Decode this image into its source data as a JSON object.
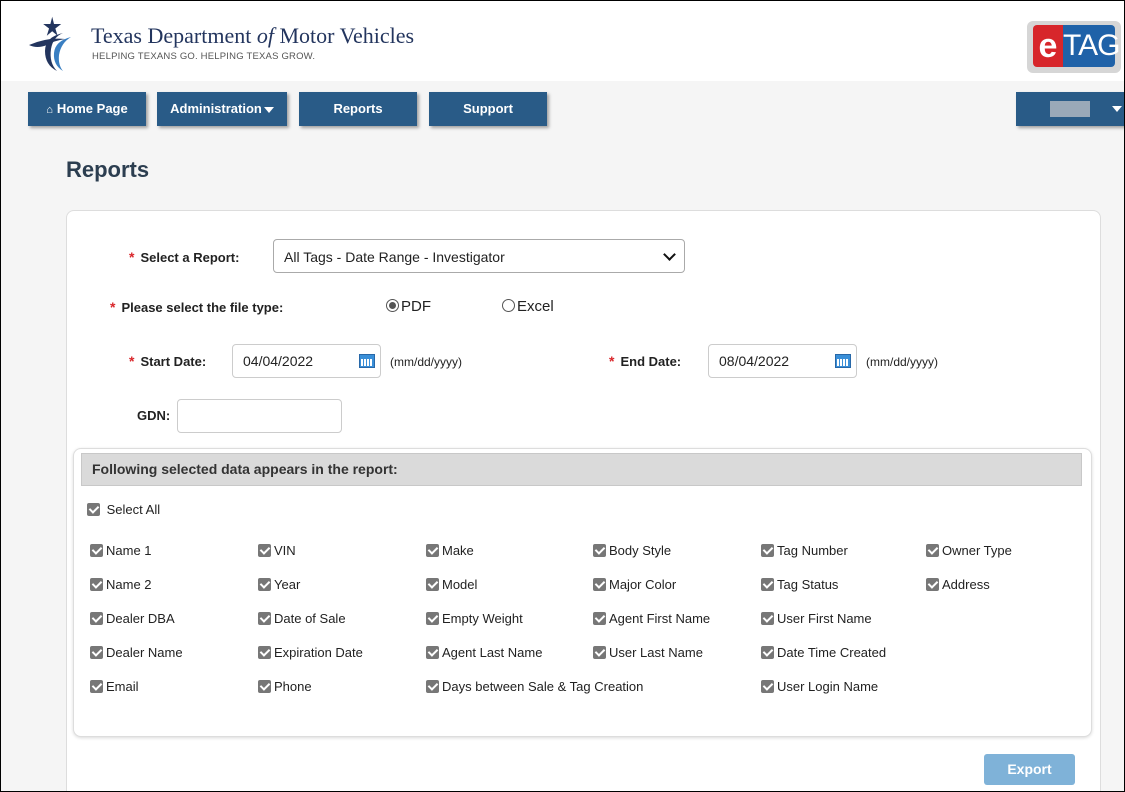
{
  "header": {
    "agency_name_part1": "Texas Department ",
    "agency_name_of": "of",
    "agency_name_part2": " Motor Vehicles",
    "tagline": "HELPING TEXANS GO. HELPING TEXAS GROW.",
    "etag_e": "e",
    "etag_tag": "TAG"
  },
  "nav": {
    "home": "Home Page",
    "administration": "Administration",
    "reports": "Reports",
    "support": "Support"
  },
  "page": {
    "title": "Reports"
  },
  "form": {
    "select_report_label": "Select a Report:",
    "select_report_value": "All Tags - Date Range - Investigator",
    "file_type_label": "Please select the file type:",
    "file_type_options": [
      "PDF",
      "Excel"
    ],
    "file_type_selected": "PDF",
    "start_date_label": "Start Date:",
    "start_date_value": "04/04/2022",
    "end_date_label": "End Date:",
    "end_date_value": "08/04/2022",
    "date_format": "(mm/dd/yyyy)",
    "gdn_label": "GDN:",
    "gdn_value": ""
  },
  "data_fields": {
    "heading": "Following selected data appears in the report:",
    "select_all": "Select All",
    "rows": [
      [
        "Name 1",
        "VIN",
        "Make",
        "Body Style",
        "Tag Number",
        "Owner Type"
      ],
      [
        "Name 2",
        "Year",
        "Model",
        "Major Color",
        "Tag Status",
        "Address"
      ],
      [
        "Dealer DBA",
        "Date of Sale",
        "Empty Weight",
        "Agent First Name",
        "User First Name"
      ],
      [
        "Dealer Name",
        "Expiration Date",
        "Agent Last Name",
        "User Last Name",
        "Date Time Created"
      ],
      [
        "Email",
        "Phone",
        "Days between Sale & Tag Creation",
        "User Login Name"
      ]
    ]
  },
  "actions": {
    "export": "Export"
  },
  "colors": {
    "nav_bg": "#295b87",
    "required": "#d9262b",
    "export_bg": "#7fb2d8",
    "etag_red": "#d7262b",
    "etag_blue": "#1f62a8"
  }
}
